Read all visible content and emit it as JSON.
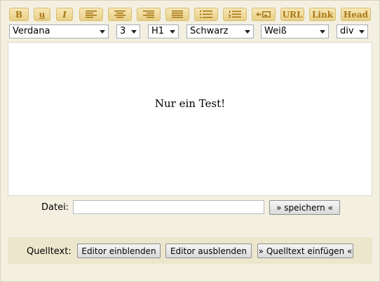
{
  "toolbar": {
    "bold": "B",
    "underline": "u",
    "italic": "I",
    "url": "URL",
    "link": "Link",
    "head": "Head"
  },
  "selects": {
    "font": "Verdana",
    "size": "3",
    "heading": "H1",
    "color": "Schwarz",
    "background": "Weiß",
    "block": "div"
  },
  "editor": {
    "content": "Nur ein Test!"
  },
  "file": {
    "label": "Datei:",
    "value": "",
    "save_button": "» speichern «"
  },
  "source": {
    "label": "Quelltext:",
    "show_button": "Editor einblenden",
    "hide_button": "Editor ausblenden",
    "insert_button": "» Quelltext einfügen «"
  },
  "colors": {
    "background": "#f3f0e2",
    "toolbar_button": "#efdc9e",
    "toolbar_text": "#a87818",
    "panel": "#ece6cc"
  }
}
